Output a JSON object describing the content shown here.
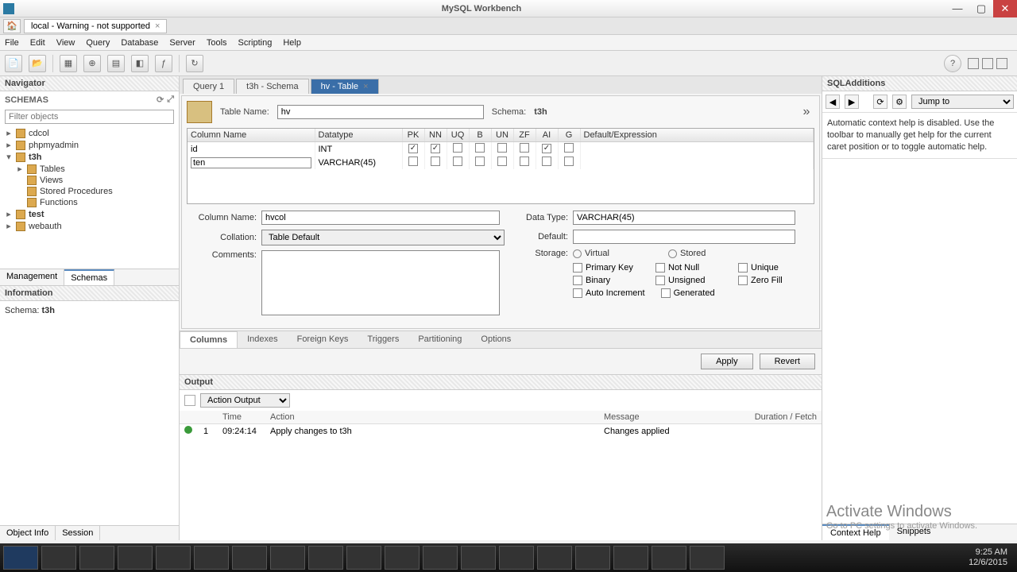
{
  "titlebar": {
    "title": "MySQL Workbench"
  },
  "connection_tab": {
    "label": "local - Warning - not supported"
  },
  "menu": [
    "File",
    "Edit",
    "View",
    "Query",
    "Database",
    "Server",
    "Tools",
    "Scripting",
    "Help"
  ],
  "left": {
    "navigator": "Navigator",
    "schemas_label": "SCHEMAS",
    "filter_placeholder": "Filter objects",
    "tree": {
      "cdcol": "cdcol",
      "phpmyadmin": "phpmyadmin",
      "t3h": "t3h",
      "tables": "Tables",
      "views": "Views",
      "sprocs": "Stored Procedures",
      "functions": "Functions",
      "test": "test",
      "webauth": "webauth"
    },
    "mgmt_tab": "Management",
    "schemas_tab": "Schemas",
    "information": "Information",
    "schema_label": "Schema:",
    "schema_val": "t3h",
    "obj_info": "Object Info",
    "session": "Session"
  },
  "editor_tabs": {
    "query1": "Query 1",
    "t3h_schema": "t3h - Schema",
    "hv_table": "hv - Table"
  },
  "te": {
    "table_name_label": "Table Name:",
    "table_name": "hv",
    "schema_label": "Schema:",
    "schema": "t3h",
    "grid_headers": [
      "Column Name",
      "Datatype",
      "PK",
      "NN",
      "UQ",
      "B",
      "UN",
      "ZF",
      "AI",
      "G",
      "Default/Expression"
    ],
    "rows": [
      {
        "name": "id",
        "datatype": "INT",
        "pk": true,
        "nn": true,
        "uq": false,
        "b": false,
        "un": false,
        "zf": false,
        "ai": true,
        "g": false,
        "def": ""
      },
      {
        "name": "ten",
        "datatype": "VARCHAR(45)",
        "pk": false,
        "nn": false,
        "uq": false,
        "b": false,
        "un": false,
        "zf": false,
        "ai": false,
        "g": false,
        "def": ""
      }
    ],
    "col_name_label": "Column Name:",
    "col_name": "hvcol",
    "collation_label": "Collation:",
    "collation": "Table Default",
    "comments_label": "Comments:",
    "datatype_label": "Data Type:",
    "datatype": "VARCHAR(45)",
    "default_label": "Default:",
    "storage_label": "Storage:",
    "virtual": "Virtual",
    "stored": "Stored",
    "primary_key": "Primary Key",
    "not_null": "Not Null",
    "unique": "Unique",
    "binary": "Binary",
    "unsigned": "Unsigned",
    "zero_fill": "Zero Fill",
    "auto_inc": "Auto Increment",
    "generated": "Generated",
    "det_tabs": [
      "Columns",
      "Indexes",
      "Foreign Keys",
      "Triggers",
      "Partitioning",
      "Options"
    ],
    "apply": "Apply",
    "revert": "Revert"
  },
  "output": {
    "header": "Output",
    "type": "Action Output",
    "cols": {
      "n": "",
      "time": "Time",
      "action": "Action",
      "message": "Message",
      "duration": "Duration / Fetch"
    },
    "row": {
      "n": "1",
      "time": "09:24:14",
      "action": "Apply changes to t3h",
      "message": "Changes applied",
      "duration": ""
    }
  },
  "right": {
    "header": "SQLAdditions",
    "jump": "Jump to",
    "help_text": "Automatic context help is disabled. Use the toolbar to manually get help for the current caret position or to toggle automatic help.",
    "context_help": "Context Help",
    "snippets": "Snippets"
  },
  "activate": {
    "h": "Activate Windows",
    "s": "Go to PC settings to activate Windows."
  },
  "clock": {
    "time": "9:25 AM",
    "date": "12/6/2015"
  }
}
